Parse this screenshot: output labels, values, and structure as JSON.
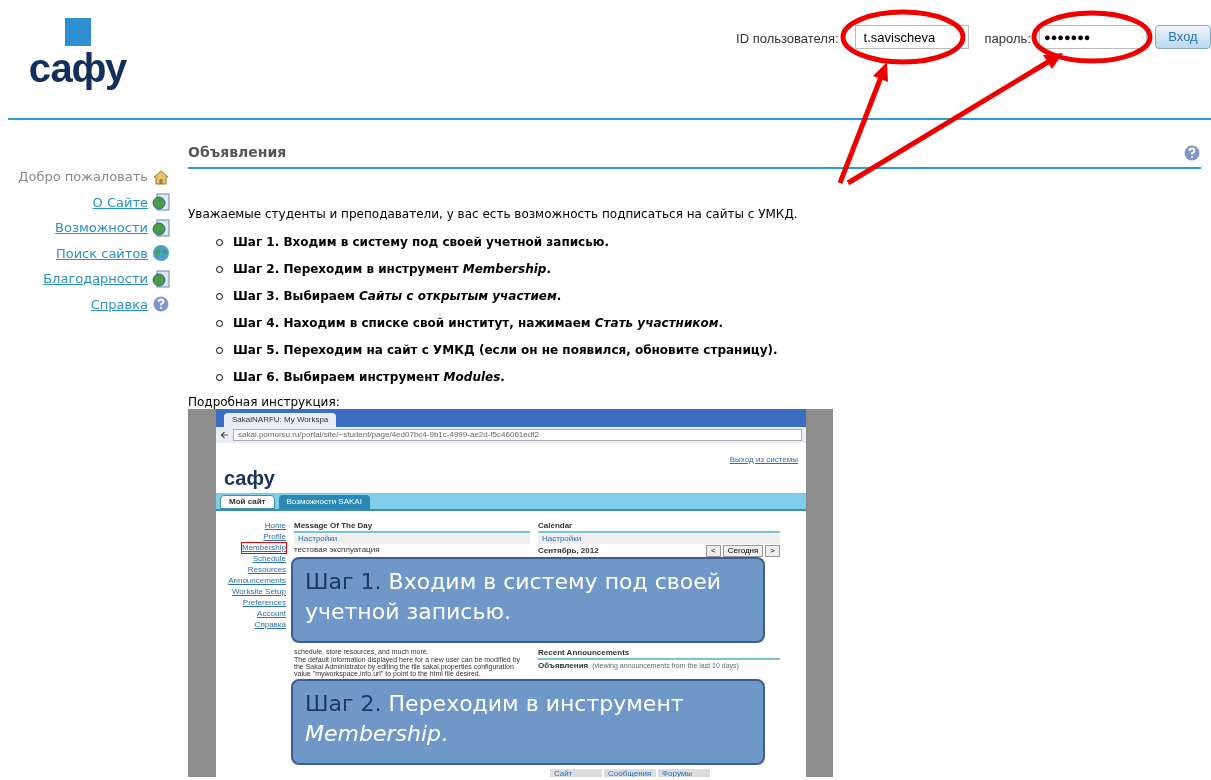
{
  "header": {
    "logo": "сафу",
    "login": {
      "user_label": "ID пользователя:",
      "username": "t.savischeva",
      "password_label": "пароль:",
      "password": "●●●●●●●",
      "button": "Вход"
    }
  },
  "sidebar": {
    "items": [
      {
        "label": "Добро пожаловать",
        "selected": true,
        "kind": "home"
      },
      {
        "label": "О Сайте",
        "selected": false,
        "kind": "page"
      },
      {
        "label": "Возможности",
        "selected": false,
        "kind": "page"
      },
      {
        "label": "Поиск сайтов",
        "selected": false,
        "kind": "globe"
      },
      {
        "label": "Благодарности",
        "selected": false,
        "kind": "page"
      },
      {
        "label": "Справка",
        "selected": false,
        "kind": "help"
      }
    ]
  },
  "main": {
    "title": "Объявления",
    "intro": "Уважаемые студенты и преподаватели, у вас есть возможность подписаться на сайты с УМКД.",
    "steps": [
      "Шаг 1. Входим в систему под своей учетной записью.",
      "Шаг 2. Переходим в инструмент *Membership*.",
      "Шаг 3. Выбираем  *Сайты с открытым участием*.",
      "Шаг 4. Находим в списке свой институт, нажимаем *Стать участником*.",
      "Шаг 5. Переходим на сайт с УМКД (если он не появился,  обновите страницу).",
      "Шаг 6. Выбираем инструмент *Modules*."
    ],
    "details_label": "Подробная инструкция:"
  },
  "embedded_screenshot": {
    "tab_title": "SakaiNARFU: My Workspa",
    "url": "sakai.pomorsu.ru/portal/site/~student/page/4ed07bc4-9b1c-4999-ae2d-f5c46061edf2",
    "logout": "Выход из системы",
    "logo": "сафу",
    "tabs": [
      {
        "label": "Мой сайт",
        "selected": true
      },
      {
        "label": "Возможности SAKAI",
        "selected": false
      }
    ],
    "sidebar": [
      {
        "label": "Home",
        "highlighted": false
      },
      {
        "label": "Profile",
        "highlighted": false
      },
      {
        "label": "Membership",
        "highlighted": true
      },
      {
        "label": "Schedule",
        "highlighted": false
      },
      {
        "label": "Resources",
        "highlighted": false
      },
      {
        "label": "Announcements",
        "highlighted": false
      },
      {
        "label": "Worksite Setup",
        "highlighted": false
      },
      {
        "label": "Preferences",
        "highlighted": false
      },
      {
        "label": "Account",
        "highlighted": false
      },
      {
        "label": "Справка",
        "highlighted": false
      }
    ],
    "motd": {
      "title": "Message Of The Day",
      "link": "Настройки",
      "text": "тестовая эксплуатация"
    },
    "welcome_text": [
      "schedule, store resources, and much more.",
      "The default information displayed here for a new user can be modified by the Sakai Administrator by editing the file sakai.properties configuration value \"myworkspace.info.url\" to point to the html file desired."
    ],
    "calendar": {
      "title": "Calendar",
      "link": "Настройки",
      "month": "Сентябрь, 2012",
      "buttons": [
        "<",
        "Сегодня",
        ">"
      ]
    },
    "announcements": {
      "title": "Recent Announcements",
      "label": "Объявления",
      "note": "(viewing announcements from the last 10 days)"
    },
    "notifications": {
      "columns": [
        "Сайт",
        "Сообщения",
        "Форумы"
      ]
    },
    "callouts": [
      "**Шаг 1.** Входим в систему под своей учетной записью.",
      "**Шаг 2.** Переходим в инструмент *Membership*."
    ]
  }
}
